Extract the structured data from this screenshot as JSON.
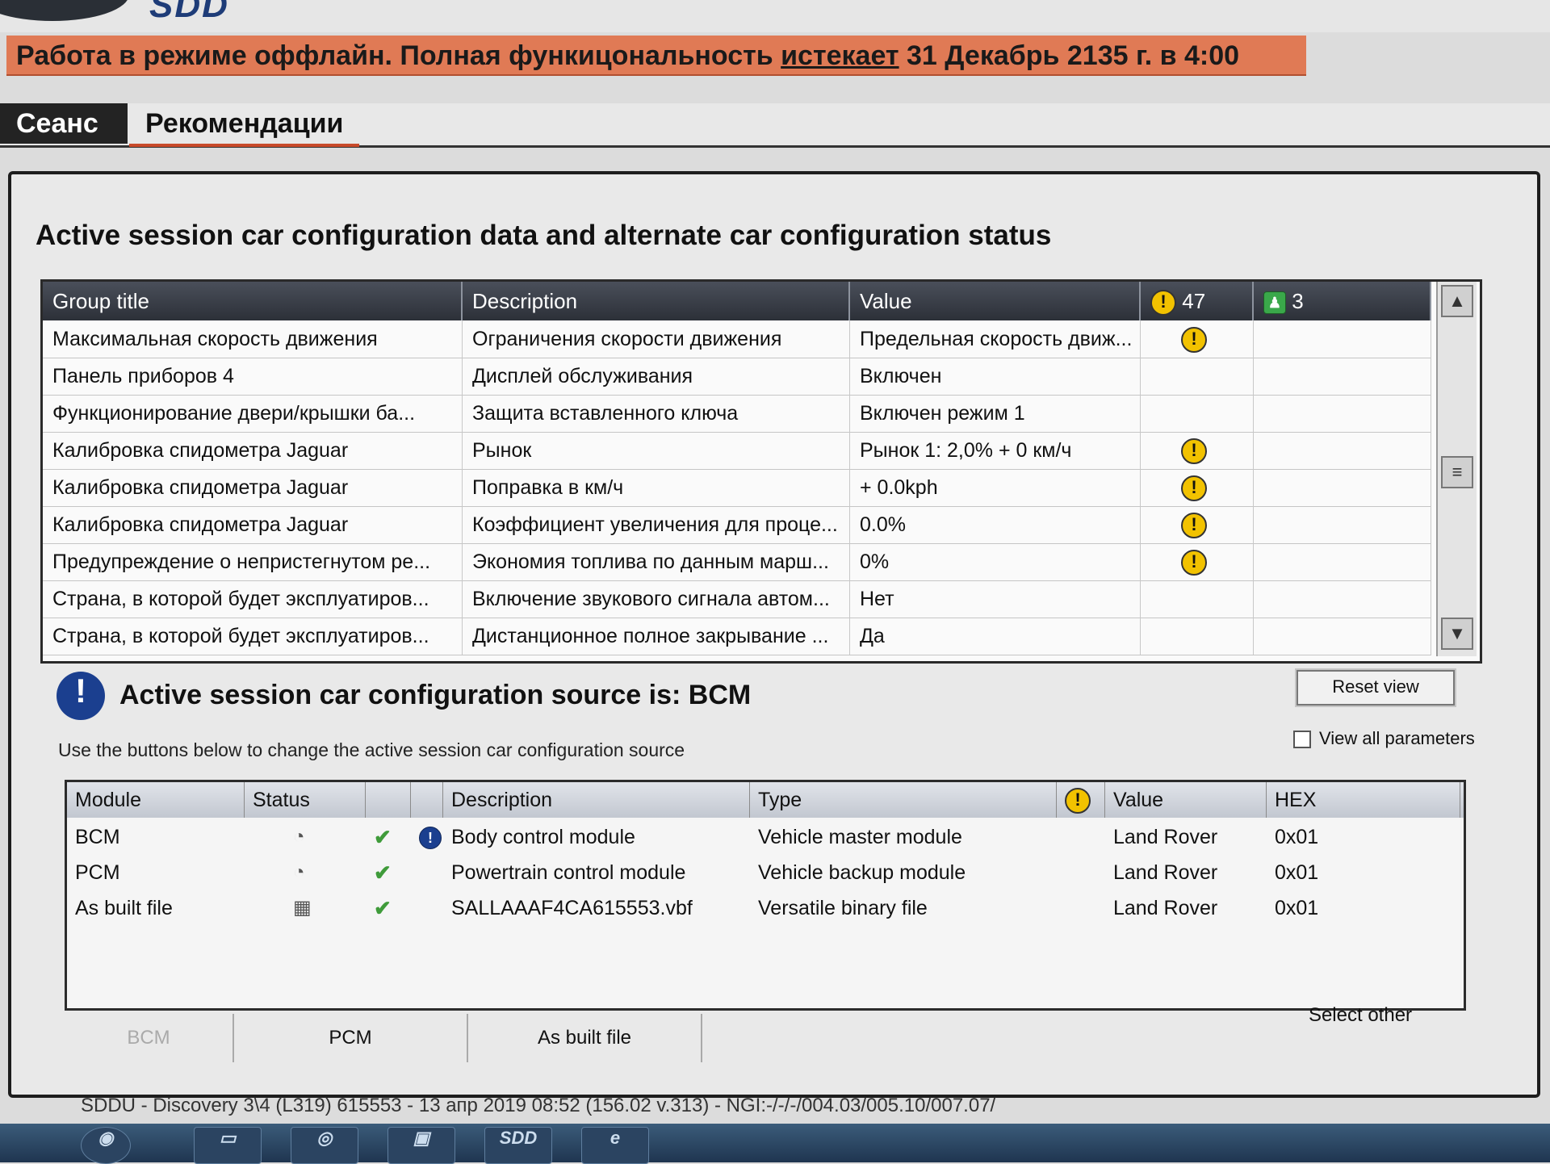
{
  "app": {
    "logo_text": "SDD"
  },
  "banner": {
    "text_before": "Работа в режиме оффлайн. Полная функицональность ",
    "link": "истекает",
    "text_after": " 31 Декабрь 2135 г. в 4:00"
  },
  "tabs": [
    {
      "label": "Сеанс"
    },
    {
      "label": "Рекомендации"
    }
  ],
  "page_title": "Active session car configuration data and alternate car configuration status",
  "config_table": {
    "headers": {
      "group": "Group title",
      "description": "Description",
      "value": "Value",
      "warn_count": "47",
      "info_count": "3"
    },
    "rows": [
      {
        "group": "Максимальная скорость движения",
        "description": "Ограничения скорости движения",
        "value": "Предельная скорость движ...",
        "warn": true
      },
      {
        "group": "Панель приборов 4",
        "description": "Дисплей обслуживания",
        "value": "Включен",
        "warn": false
      },
      {
        "group": "Функционирование двери/крышки ба...",
        "description": "Защита вставленного ключа",
        "value": "Включен режим 1",
        "warn": false
      },
      {
        "group": "Калибровка спидометра Jaguar",
        "description": "Рынок",
        "value": "Рынок 1: 2,0% + 0 км/ч",
        "warn": true
      },
      {
        "group": "Калибровка спидометра Jaguar",
        "description": "Поправка в км/ч",
        "value": "+ 0.0kph",
        "warn": true
      },
      {
        "group": "Калибровка спидометра Jaguar",
        "description": "Коэффициент увеличения для проце...",
        "value": "0.0%",
        "warn": true
      },
      {
        "group": "Предупреждение о непристегнутом ре...",
        "description": "Экономия топлива по данным марш...",
        "value": "0%",
        "warn": true
      },
      {
        "group": "Страна, в которой будет эксплуатиров...",
        "description": "Включение звукового сигнала автом...",
        "value": "Нет",
        "warn": false
      },
      {
        "group": "Страна, в которой будет эксплуатиров...",
        "description": "Дистанционное полное закрывание ...",
        "value": "Да",
        "warn": false
      }
    ]
  },
  "source": {
    "icon_glyph": "!",
    "title": "Active session car configuration source is: BCM",
    "subtitle": "Use the buttons below to change the active session car configuration source",
    "reset_label": "Reset view",
    "view_all_label": "View all parameters"
  },
  "module_table": {
    "headers": {
      "module": "Module",
      "status": "Status",
      "description": "Description",
      "type": "Type",
      "value": "Value",
      "hex": "HEX"
    },
    "rows": [
      {
        "module": "BCM",
        "description": "Body control module",
        "type": "Vehicle master module",
        "value": "Land Rover",
        "hex": "0x01",
        "active": true
      },
      {
        "module": "PCM",
        "description": "Powertrain control module",
        "type": "Vehicle backup module",
        "value": "Land Rover",
        "hex": "0x01",
        "active": false
      },
      {
        "module": "As built file",
        "description": "SALLAAAF4CA615553.vbf",
        "type": "Versatile binary file",
        "value": "Land Rover",
        "hex": "0x01",
        "active": false
      }
    ]
  },
  "bottom_buttons": {
    "bcm": "BCM",
    "pcm": "PCM",
    "as_built": "As built file",
    "select_other": "Select other"
  },
  "status_line": "SDDU - Discovery 3\\4 (L319) 615553 - 13 апр 2019 08:52 (156.02 v.313) - NGI:-/-/-/004.03/005.10/007.07/",
  "taskbar": {
    "sdd_label": "SDD"
  },
  "colors": {
    "banner": "#e07a55",
    "header_dark": "#2c3038",
    "accent_tab": "#c84a2a",
    "source_icon": "#1b3f8f"
  }
}
